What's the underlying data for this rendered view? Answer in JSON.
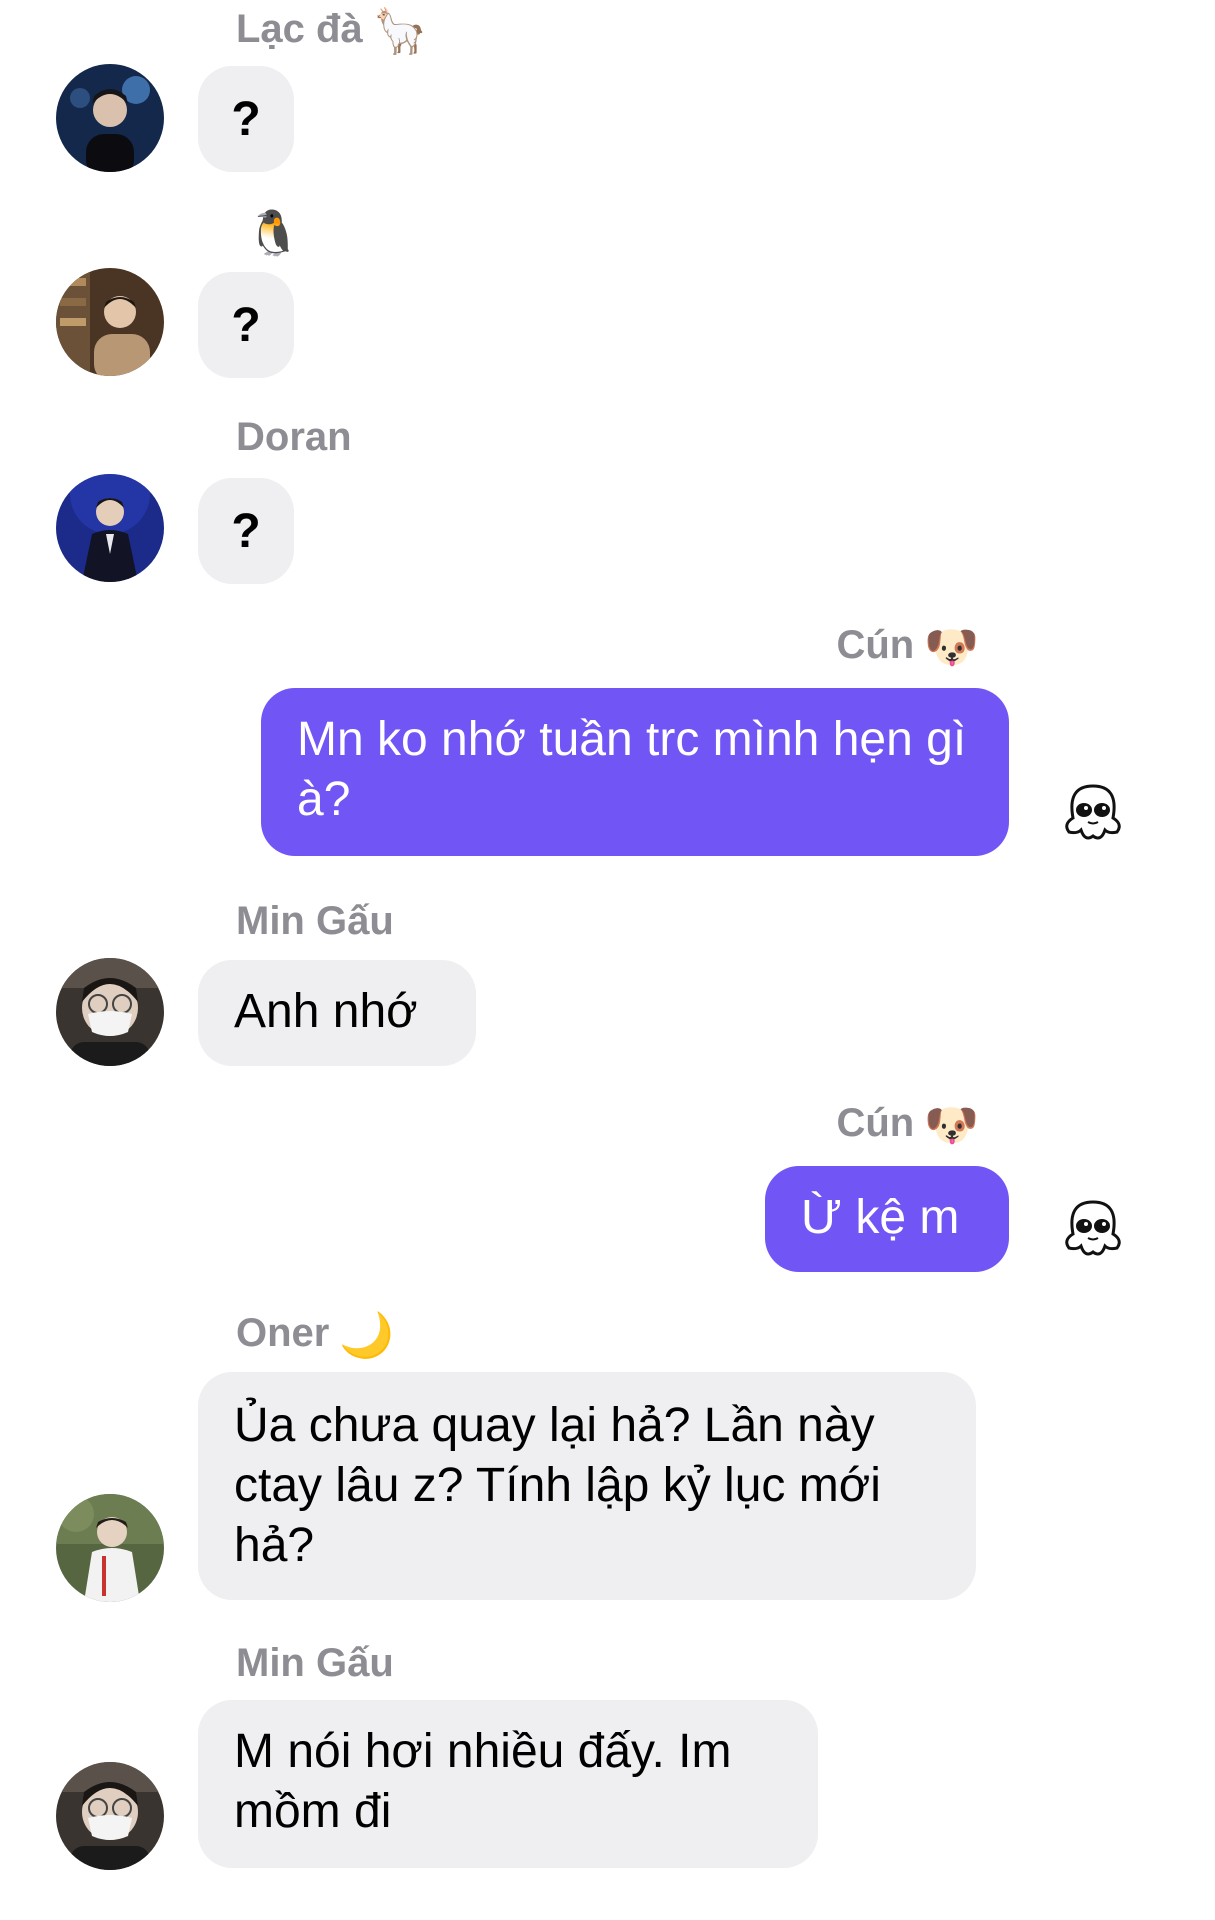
{
  "messages": [
    {
      "sender": "Lạc đà",
      "sender_emoji": "🦙",
      "text": "?"
    },
    {
      "sender": "",
      "sender_emoji": "🐧",
      "text": "?"
    },
    {
      "sender": "Doran",
      "sender_emoji": "",
      "text": "?"
    },
    {
      "sender": "Cún",
      "sender_emoji": "🐶",
      "text": "Mn ko nhớ tuần trc mình hẹn gì à?",
      "mine": true,
      "reaction": "ghost-sticker"
    },
    {
      "sender": "Min Gấu",
      "sender_emoji": "",
      "text": "Anh nhớ"
    },
    {
      "sender": "Cún",
      "sender_emoji": "🐶",
      "text": "Ừ kệ m",
      "mine": true,
      "reaction": "ghost-sticker"
    },
    {
      "sender": "Oner",
      "sender_emoji": "🌙",
      "text": "Ủa chưa quay lại hả? Lần này ctay lâu z? Tính lập kỷ lục mới hả?"
    },
    {
      "sender": "Min Gấu",
      "sender_emoji": "",
      "text": "M nói hơi nhiều đấy. Im mồm đi"
    }
  ],
  "colors": {
    "outgoing_bubble": "#7255f5",
    "incoming_bubble": "#efeff2",
    "sender_name": "#8d8d93"
  }
}
